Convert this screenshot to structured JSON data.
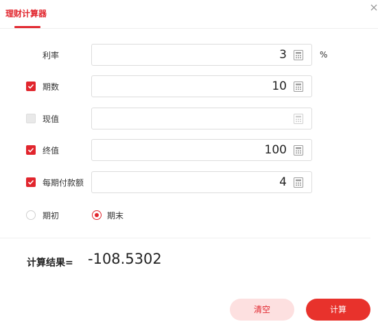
{
  "header": {
    "tab_title": "理财计算器",
    "close_glyph": "×"
  },
  "rows": [
    {
      "label": "利率",
      "checked": null,
      "value": "3",
      "unit": "%"
    },
    {
      "label": "期数",
      "checked": true,
      "value": "10"
    },
    {
      "label": "现值",
      "checked": false,
      "value": ""
    },
    {
      "label": "终值",
      "checked": true,
      "value": "100"
    },
    {
      "label": "每期付款额",
      "checked": true,
      "value": "4"
    }
  ],
  "timing": {
    "options": [
      "期初",
      "期末"
    ],
    "selected": "期末"
  },
  "result": {
    "label": "计算结果=",
    "value": "-108.5302"
  },
  "buttons": {
    "clear": "清空",
    "calculate": "计算"
  },
  "icons": {
    "checkbox": "check-icon",
    "field": "calculator-icon",
    "close": "close-icon"
  },
  "colors": {
    "accent": "#e1252d",
    "clear_button_bg": "#fde0e0",
    "calc_button_bg": "#e8322c"
  }
}
